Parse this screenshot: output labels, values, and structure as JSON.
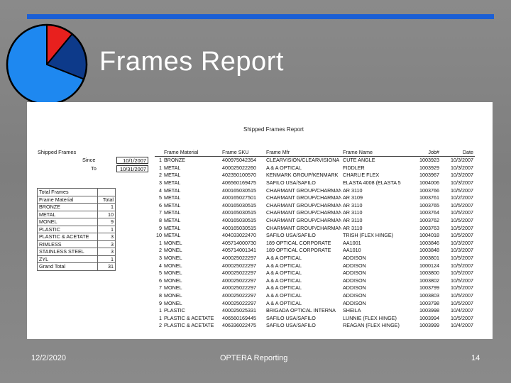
{
  "slide": {
    "title": "Frames Report",
    "footer_date": "12/2/2020",
    "footer_center": "OPTERA Reporting",
    "page_number": "14"
  },
  "pie_chart": {
    "slices": [
      {
        "fraction": 0.11,
        "color": "#e8201e"
      },
      {
        "fraction": 0.2,
        "color": "#0d3a8a"
      },
      {
        "fraction": 0.69,
        "color": "#1e88f0"
      }
    ]
  },
  "report": {
    "title": "Shipped Frames Report",
    "filters": {
      "label": "Shipped Frames",
      "since_label": "Since",
      "since_value": "10/1/2007",
      "to_label": "To",
      "to_value": "10/31/2007"
    },
    "totals": {
      "header": "Total Frames",
      "col1": "Frame Material",
      "col2": "Total",
      "rows": [
        {
          "label": "BRONZE",
          "value": "1"
        },
        {
          "label": "METAL",
          "value": "10"
        },
        {
          "label": "MONEL",
          "value": "9"
        },
        {
          "label": "PLASTIC",
          "value": "1"
        },
        {
          "label": "PLASTIC & ACETATE",
          "value": "3"
        },
        {
          "label": "RIMLESS",
          "value": "3"
        },
        {
          "label": "STAINLESS STEEL",
          "value": "3"
        },
        {
          "label": "ZYL",
          "value": "1"
        }
      ],
      "grand_label": "Grand Total",
      "grand_value": "31"
    },
    "columns": [
      "Frame Material",
      "Frame SKU",
      "Frame Mfr",
      "Frame Name",
      "Job#",
      "Date"
    ],
    "rows": [
      [
        "1",
        "BRONZE",
        "400975042354",
        "CLEARVISION/CLEARVISIONA",
        "CUTE ANGLE",
        "1003923",
        "10/3/2007"
      ],
      [
        "1",
        "METAL",
        "400025022260",
        "A & A OPTICAL",
        "FIDDLER",
        "1003929",
        "10/3/2007"
      ],
      [
        "2",
        "METAL",
        "402350100570",
        "KENMARK GROUP/KENMARK",
        "CHARLIE FLEX",
        "1003967",
        "10/3/2007"
      ],
      [
        "3",
        "METAL",
        "406560169475",
        "SAFILO USA/SAFILO",
        "ELASTA 4008 (ELASTA 5",
        "1004006",
        "10/3/2007"
      ],
      [
        "4",
        "METAL",
        "400165030515",
        "CHARMANT GROUP/CHARMANT",
        "AR 3110",
        "1003766",
        "10/5/2007"
      ],
      [
        "5",
        "METAL",
        "400165027501",
        "CHARMANT GROUP/CHARMANT",
        "AR 3109",
        "1003761",
        "10/2/2007"
      ],
      [
        "6",
        "METAL",
        "400165030515",
        "CHARMANT GROUP/CHARMANT",
        "AR 3110",
        "1003765",
        "10/5/2007"
      ],
      [
        "7",
        "METAL",
        "400165030515",
        "CHARMANT GROUP/CHARMANT",
        "AR 3110",
        "1003764",
        "10/5/2007"
      ],
      [
        "8",
        "METAL",
        "400165030515",
        "CHARMANT GROUP/CHARMANT",
        "AR 3110",
        "1003762",
        "10/5/2007"
      ],
      [
        "9",
        "METAL",
        "400165030515",
        "CHARMANT GROUP/CHARMANT",
        "AR 3110",
        "1003763",
        "10/5/2007"
      ],
      [
        "10",
        "METAL",
        "404033022470",
        "SAFILO USA/SAFILO",
        "TRISH (FLEX HINGE)",
        "1004018",
        "10/5/2007"
      ],
      [
        "1",
        "MONEL",
        "405714000730",
        "189 OPTICAL CORPORATE",
        "AA1001",
        "1003846",
        "10/3/2007"
      ],
      [
        "2",
        "MONEL",
        "405714001341",
        "189 OPTICAL CORPORATE",
        "AA1010",
        "1003848",
        "10/3/2007"
      ],
      [
        "3",
        "MONEL",
        "400025022297",
        "A & A OPTICAL",
        "ADDISON",
        "1003801",
        "10/5/2007"
      ],
      [
        "4",
        "MONEL",
        "400025022297",
        "A & A OPTICAL",
        "ADDISON",
        "1000124",
        "10/5/2007"
      ],
      [
        "5",
        "MONEL",
        "400025022297",
        "A & A OPTICAL",
        "ADDISON",
        "1003800",
        "10/5/2007"
      ],
      [
        "6",
        "MONEL",
        "400025022297",
        "A & A OPTICAL",
        "ADDISON",
        "1003802",
        "10/5/2007"
      ],
      [
        "7",
        "MONEL",
        "400025022297",
        "A & A OPTICAL",
        "ADDISON",
        "1003799",
        "10/5/2007"
      ],
      [
        "8",
        "MONEL",
        "400025022297",
        "A & A OPTICAL",
        "ADDISON",
        "1003803",
        "10/5/2007"
      ],
      [
        "9",
        "MONEL",
        "400025022297",
        "A & A OPTICAL",
        "ADDISON",
        "1003798",
        "10/5/2007"
      ],
      [
        "1",
        "PLASTIC",
        "400025025331",
        "BRIGADA OPTICAL INTERNA",
        "SHEILA",
        "1003998",
        "10/4/2007"
      ],
      [
        "1",
        "PLASTIC & ACETATE",
        "406560169445",
        "SAFILO USA/SAFILO",
        "LUNNIE (FLEX HINGE)",
        "1003994",
        "10/5/2007"
      ],
      [
        "2",
        "PLASTIC & ACETATE",
        "406336022475",
        "SAFILO USA/SAFILO",
        "REAGAN (FLEX HINGE)",
        "1003999",
        "10/4/2007"
      ]
    ]
  }
}
